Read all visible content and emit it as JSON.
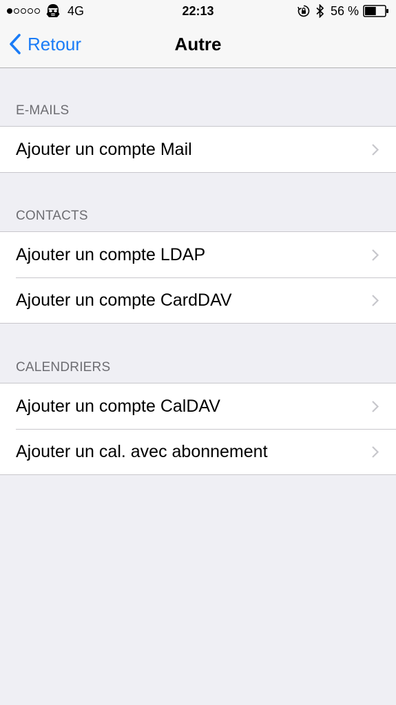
{
  "status_bar": {
    "signal_dots": [
      true,
      false,
      false,
      false,
      false
    ],
    "carrier_icon": "stormtrooper-icon",
    "network": "4G",
    "time": "22:13",
    "rotation_lock_icon": "rotation-lock-icon",
    "bluetooth_icon": "bluetooth-icon",
    "battery_percent_text": "56 %",
    "battery_level": 0.56
  },
  "nav": {
    "back_label": "Retour",
    "title": "Autre"
  },
  "sections": [
    {
      "header": "E-MAILS",
      "items": [
        {
          "label": "Ajouter un compte Mail"
        }
      ]
    },
    {
      "header": "CONTACTS",
      "items": [
        {
          "label": "Ajouter un compte LDAP"
        },
        {
          "label": "Ajouter un compte CardDAV"
        }
      ]
    },
    {
      "header": "CALENDRIERS",
      "items": [
        {
          "label": "Ajouter un compte CalDAV"
        },
        {
          "label": "Ajouter un cal. avec abonnement"
        }
      ]
    }
  ],
  "colors": {
    "accent": "#1a7cf7",
    "background": "#efeff4",
    "section_header": "#6d6d72",
    "separator": "#c8c7cc",
    "chevron": "#c7c7cc"
  }
}
